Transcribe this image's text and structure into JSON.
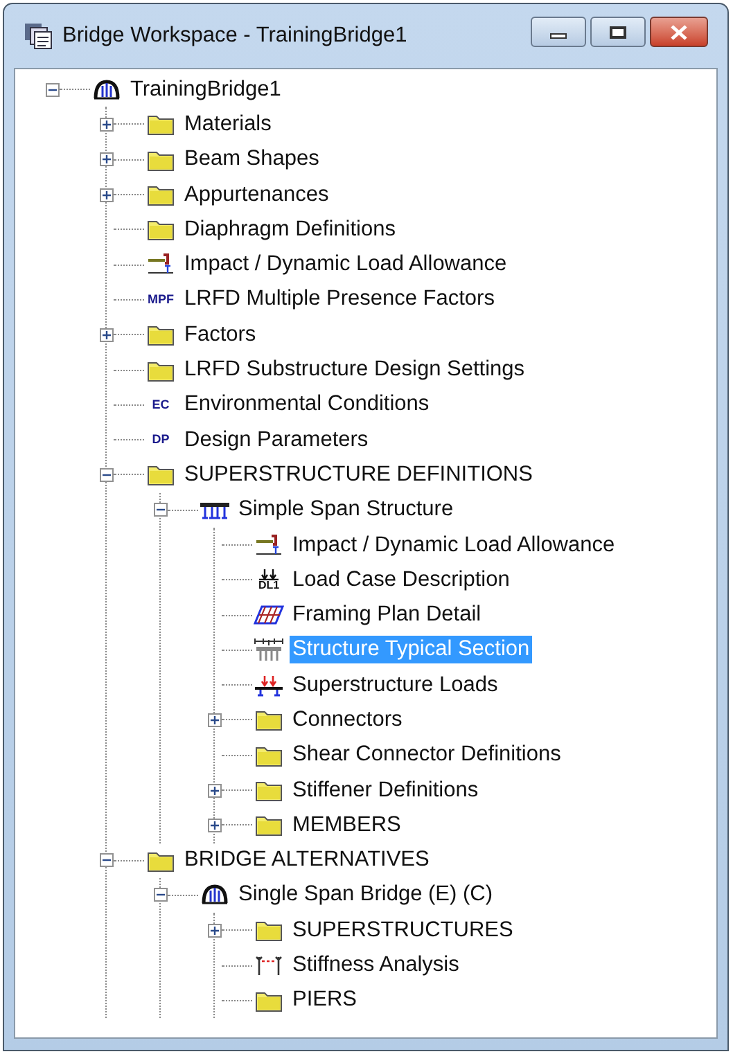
{
  "window": {
    "title": "Bridge Workspace - TrainingBridge1"
  },
  "tree": [
    {
      "label": "TrainingBridge1",
      "kind": "bridge",
      "expanded": true,
      "selected": false,
      "children": [
        {
          "label": "Materials",
          "kind": "folder",
          "expanded": false,
          "selected": false
        },
        {
          "label": "Beam Shapes",
          "kind": "folder",
          "expanded": false,
          "selected": false
        },
        {
          "label": "Appurtenances",
          "kind": "folder",
          "expanded": false,
          "selected": false
        },
        {
          "label": "Diaphragm Definitions",
          "kind": "folder",
          "selected": false
        },
        {
          "label": "Impact / Dynamic Load Allowance",
          "kind": "impact",
          "selected": false
        },
        {
          "label": "LRFD Multiple Presence Factors",
          "kind": "badge",
          "badge": "MPF",
          "selected": false
        },
        {
          "label": "Factors",
          "kind": "folder",
          "expanded": false,
          "selected": false
        },
        {
          "label": "LRFD Substructure Design Settings",
          "kind": "folder",
          "selected": false
        },
        {
          "label": "Environmental Conditions",
          "kind": "badge",
          "badge": "EC",
          "selected": false
        },
        {
          "label": "Design Parameters",
          "kind": "badge",
          "badge": "DP",
          "selected": false
        },
        {
          "label": "SUPERSTRUCTURE DEFINITIONS",
          "kind": "folder",
          "expanded": true,
          "selected": false,
          "children": [
            {
              "label": "Simple Span Structure",
              "kind": "structure",
              "expanded": true,
              "selected": false,
              "children": [
                {
                  "label": "Impact / Dynamic Load Allowance",
                  "kind": "impact",
                  "selected": false
                },
                {
                  "label": "Load Case Description",
                  "kind": "loadcase",
                  "badge": "DL1",
                  "selected": false
                },
                {
                  "label": "Framing Plan Detail",
                  "kind": "framing",
                  "selected": false
                },
                {
                  "label": "Structure Typical Section",
                  "kind": "section",
                  "selected": true
                },
                {
                  "label": "Superstructure Loads",
                  "kind": "loads",
                  "selected": false
                },
                {
                  "label": "Connectors",
                  "kind": "folder",
                  "expanded": false,
                  "selected": false
                },
                {
                  "label": "Shear Connector Definitions",
                  "kind": "folder",
                  "selected": false
                },
                {
                  "label": "Stiffener Definitions",
                  "kind": "folder",
                  "expanded": false,
                  "selected": false
                },
                {
                  "label": "MEMBERS",
                  "kind": "folder",
                  "expanded": false,
                  "selected": false
                }
              ]
            }
          ]
        },
        {
          "label": "BRIDGE ALTERNATIVES",
          "kind": "folder",
          "expanded": true,
          "selected": false,
          "children": [
            {
              "label": "Single Span Bridge (E) (C)",
              "kind": "bridge",
              "expanded": true,
              "selected": false,
              "children": [
                {
                  "label": "SUPERSTRUCTURES",
                  "kind": "folder",
                  "expanded": false,
                  "selected": false
                },
                {
                  "label": "Stiffness Analysis",
                  "kind": "stiffness",
                  "selected": false
                },
                {
                  "label": "PIERS",
                  "kind": "folder",
                  "selected": false
                }
              ]
            }
          ]
        }
      ]
    }
  ]
}
